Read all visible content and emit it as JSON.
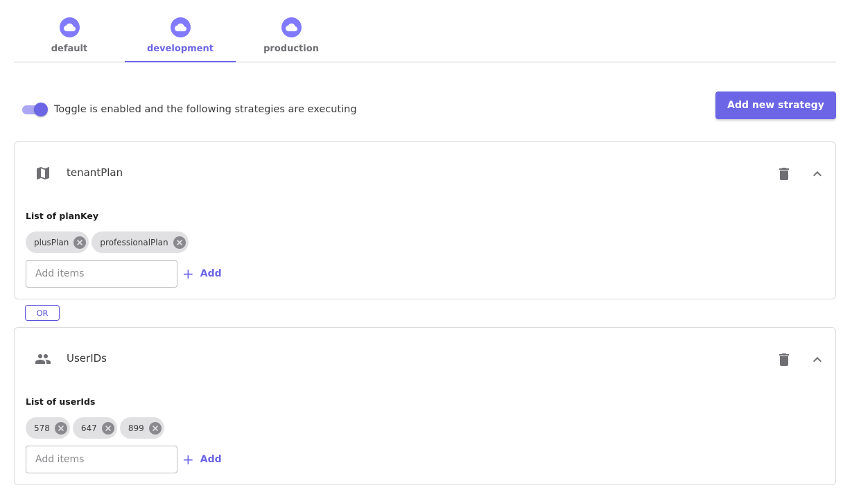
{
  "tabs": [
    {
      "label": "default",
      "icon": "cloud-icon",
      "active": false
    },
    {
      "label": "development",
      "icon": "cloud-icon",
      "active": true
    },
    {
      "label": "production",
      "icon": "cloud-icon",
      "active": false
    }
  ],
  "toggle": {
    "enabled": true,
    "text": "Toggle is enabled and the following strategies are executing"
  },
  "add_strategy_label": "Add new strategy",
  "strategies": [
    {
      "title": "tenantPlan",
      "icon": "map-icon",
      "list_label": "List of planKey",
      "chips": [
        "plusPlan",
        "professionalPlan"
      ],
      "input_placeholder": "Add items",
      "add_label": "Add"
    },
    {
      "title": "UserIDs",
      "icon": "people-icon",
      "list_label": "List of userIds",
      "chips": [
        "578",
        "647",
        "899"
      ],
      "input_placeholder": "Add items",
      "add_label": "Add"
    }
  ],
  "or_label": "OR",
  "colors": {
    "accent": "#6c65e5",
    "tab_icon": "#817afe",
    "chip_bg": "#e1e1e3",
    "border": "#dcdce0"
  }
}
